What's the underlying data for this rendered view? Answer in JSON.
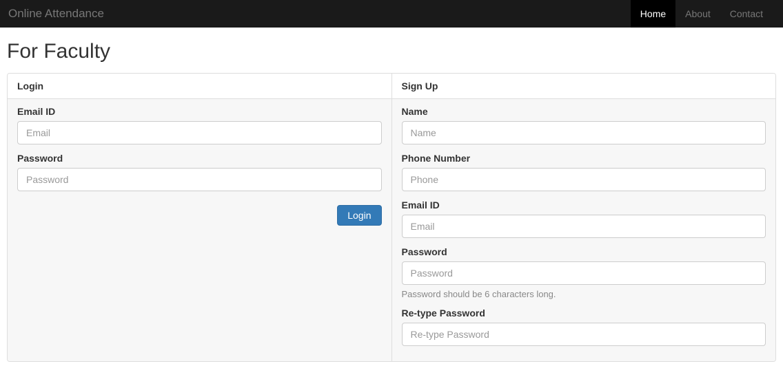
{
  "navbar": {
    "brand": "Online Attendance",
    "links": {
      "home": "Home",
      "about": "About",
      "contact": "Contact"
    }
  },
  "page": {
    "title": "For Faculty"
  },
  "login": {
    "heading": "Login",
    "email_label": "Email ID",
    "email_placeholder": "Email",
    "password_label": "Password",
    "password_placeholder": "Password",
    "submit_label": "Login"
  },
  "signup": {
    "heading": "Sign Up",
    "name_label": "Name",
    "name_placeholder": "Name",
    "phone_label": "Phone Number",
    "phone_placeholder": "Phone",
    "email_label": "Email ID",
    "email_placeholder": "Email",
    "password_label": "Password",
    "password_placeholder": "Password",
    "password_help": "Password should be 6 characters long.",
    "repassword_label": "Re-type Password",
    "repassword_placeholder": "Re-type Password"
  }
}
